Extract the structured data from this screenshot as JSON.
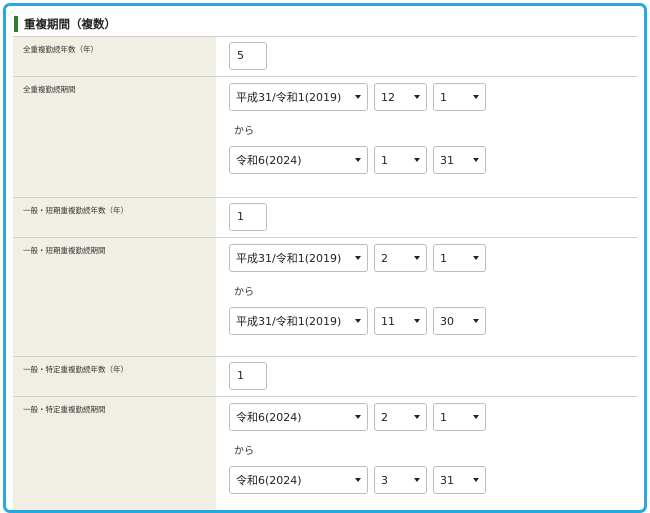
{
  "section": {
    "title": "重複期間（複数）"
  },
  "rows": [
    {
      "label": "全重複勤続年数（年）",
      "value": "5"
    },
    {
      "label": "全重複勤続期間",
      "from": {
        "era": "平成31/令和1(2019)",
        "month": "12",
        "day": "1"
      },
      "sep": "から",
      "to": {
        "era": "令和6(2024)",
        "month": "1",
        "day": "31"
      }
    },
    {
      "label": "一般・短期重複勤続年数（年）",
      "value": "1"
    },
    {
      "label": "一般・短期重複勤続期間",
      "from": {
        "era": "平成31/令和1(2019)",
        "month": "2",
        "day": "1"
      },
      "sep": "から",
      "to": {
        "era": "平成31/令和1(2019)",
        "month": "11",
        "day": "30"
      }
    },
    {
      "label": "一般・特定重複勤続年数（年）",
      "value": "1"
    },
    {
      "label": "一般・特定重複勤続期間",
      "from": {
        "era": "令和6(2024)",
        "month": "2",
        "day": "1"
      },
      "sep": "から",
      "to": {
        "era": "令和6(2024)",
        "month": "3",
        "day": "31"
      }
    }
  ],
  "colors": {
    "frame": "#29a7e1",
    "accent_bar": "#2e7d32",
    "label_bg": "#f1efe4"
  }
}
